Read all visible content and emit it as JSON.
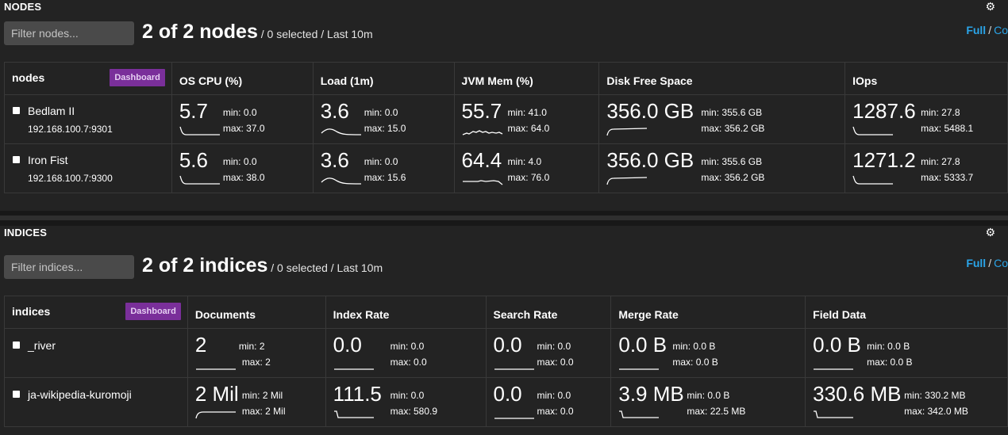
{
  "nodes_panel": {
    "title": "NODES",
    "filter_placeholder": "Filter nodes...",
    "count_text": "2 of 2 nodes",
    "meta_text": " / 0 selected / Last 10m",
    "view_full": "Full",
    "view_sep": "/",
    "view_compact": "Co",
    "header": {
      "first": "nodes",
      "dashboard": "Dashboard",
      "columns": [
        "OS CPU (%)",
        "Load (1m)",
        "JVM Mem (%)",
        "Disk Free Space",
        "IOps"
      ]
    },
    "rows": [
      {
        "name": "Bedlam II",
        "address": "192.168.100.7:9301",
        "cells": [
          {
            "value": "5.7",
            "min": "min: 0.0",
            "max": "max: 37.0",
            "spark": "drop"
          },
          {
            "value": "3.6",
            "min": "min: 0.0",
            "max": "max: 15.0",
            "spark": "decay"
          },
          {
            "value": "55.7",
            "min": "min: 41.0",
            "max": "max: 64.0",
            "spark": "wavy"
          },
          {
            "value": "356.0 GB",
            "min": "min: 355.6 GB",
            "max": "max: 356.2 GB",
            "spark": "rise"
          },
          {
            "value": "1287.6",
            "min": "min: 27.8",
            "max": "max: 5488.1",
            "spark": "drop"
          }
        ]
      },
      {
        "name": "Iron Fist",
        "address": "192.168.100.7:9300",
        "cells": [
          {
            "value": "5.6",
            "min": "min: 0.0",
            "max": "max: 38.0",
            "spark": "drop"
          },
          {
            "value": "3.6",
            "min": "min: 0.0",
            "max": "max: 15.6",
            "spark": "decay"
          },
          {
            "value": "64.4",
            "min": "min: 4.0",
            "max": "max: 76.0",
            "spark": "flatdip"
          },
          {
            "value": "356.0 GB",
            "min": "min: 355.6 GB",
            "max": "max: 356.2 GB",
            "spark": "rise"
          },
          {
            "value": "1271.2",
            "min": "min: 27.8",
            "max": "max: 5333.7",
            "spark": "drop"
          }
        ]
      }
    ]
  },
  "indices_panel": {
    "title": "INDICES",
    "filter_placeholder": "Filter indices...",
    "count_text": "2 of 2 indices",
    "meta_text": " / 0 selected / Last 10m",
    "view_full": "Full",
    "view_sep": "/",
    "view_compact": "Co",
    "header": {
      "first": "indices",
      "dashboard": "Dashboard",
      "columns": [
        "Documents",
        "Index Rate",
        "Search Rate",
        "Merge Rate",
        "Field Data"
      ]
    },
    "rows": [
      {
        "name": "_river",
        "cells": [
          {
            "value": "2",
            "min": "min: 2",
            "max": "max: 2",
            "spark": "flat"
          },
          {
            "value": "0.0",
            "min": "min: 0.0",
            "max": "max: 0.0",
            "spark": "flat"
          },
          {
            "value": "0.0",
            "min": "min: 0.0",
            "max": "max: 0.0",
            "spark": "flat"
          },
          {
            "value": "0.0 B",
            "min": "min: 0.0 B",
            "max": "max: 0.0 B",
            "spark": "flat"
          },
          {
            "value": "0.0 B",
            "min": "min: 0.0 B",
            "max": "max: 0.0 B",
            "spark": "flat"
          }
        ]
      },
      {
        "name": "ja-wikipedia-kuromoji",
        "cells": [
          {
            "value": "2 Mil",
            "min": "min: 2 Mil",
            "max": "max: 2 Mil",
            "spark": "curve"
          },
          {
            "value": "111.5",
            "min": "min: 0.0",
            "max": "max: 580.9",
            "spark": "stepdrop"
          },
          {
            "value": "0.0",
            "min": "min: 0.0",
            "max": "max: 0.0",
            "spark": "flat"
          },
          {
            "value": "3.9 MB",
            "min": "min: 0.0 B",
            "max": "max: 22.5 MB",
            "spark": "stepdrop"
          },
          {
            "value": "330.6 MB",
            "min": "min: 330.2 MB",
            "max": "max: 342.0 MB",
            "spark": "stepdrop"
          }
        ]
      }
    ]
  }
}
